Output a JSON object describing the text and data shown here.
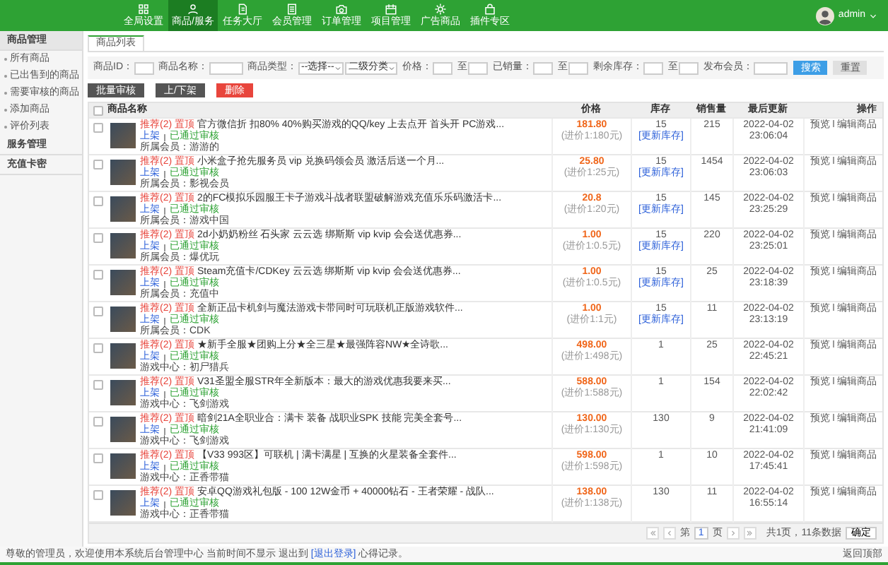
{
  "nav": [
    {
      "label": "全局设置",
      "selected": false
    },
    {
      "label": "商品/服务",
      "selected": true
    },
    {
      "label": "任务大厅",
      "selected": false
    },
    {
      "label": "会员管理",
      "selected": false
    },
    {
      "label": "订单管理",
      "selected": false
    },
    {
      "label": "项目管理",
      "selected": false
    },
    {
      "label": "广告商品",
      "selected": false
    },
    {
      "label": "插件专区",
      "selected": false
    }
  ],
  "user": {
    "name": "admin"
  },
  "sidebar": {
    "groups": [
      {
        "title": "商品管理",
        "expanded": true,
        "items": [
          {
            "label": "所有商品",
            "selected": false
          },
          {
            "label": "已出售到的商品",
            "selected": false
          },
          {
            "label": "需要审核的商品",
            "selected": false
          },
          {
            "label": "添加商品",
            "selected": false
          },
          {
            "label": "评价列表",
            "selected": false
          }
        ]
      },
      {
        "title": "服务管理",
        "expanded": false
      },
      {
        "title": "充值卡密",
        "expanded": false
      }
    ]
  },
  "tabs": [
    {
      "label": "商品列表",
      "selected": true
    }
  ],
  "filters": [
    {
      "label": "商品ID：",
      "kind": "input"
    },
    {
      "label": "商品名称：",
      "kind": "wide"
    },
    {
      "label": "商品类型：",
      "kind": "select",
      "value": "--选择--"
    },
    {
      "kind": "select",
      "value": "二级分类"
    },
    {
      "label": "价格：",
      "kind": "input"
    },
    {
      "label": "至",
      "kind": "input"
    },
    {
      "label": "已销量：",
      "kind": "input"
    },
    {
      "label": "至",
      "kind": "input"
    },
    {
      "label": "剩余库存：",
      "kind": "input"
    },
    {
      "label": "至",
      "kind": "input"
    },
    {
      "label": "发布会员：",
      "kind": "wide"
    }
  ],
  "filter_buttons": [
    {
      "label": "搜索",
      "kind": "primary"
    },
    {
      "label": "重置",
      "kind": "default"
    }
  ],
  "actions": [
    {
      "label": "批量审核",
      "kind": "dark"
    },
    {
      "label": "上/下架",
      "kind": "dark"
    },
    {
      "label": "删除",
      "kind": "danger"
    }
  ],
  "table": {
    "all_checked": false,
    "columns": [
      "商品名称",
      "价格",
      "库存",
      "销售量",
      "最后更新",
      "操作"
    ],
    "rows": [
      {
        "checked": false,
        "tags": "推荐(2) 置顶",
        "title": "官方微信折 扣80% 40%购买游戏的QQ/key 上去点开 首头开 PC游戏...",
        "status": "上架",
        "review": "已通过审核",
        "seller": "所属会员：游游的",
        "price": "181.80",
        "price_note": "(进价1:180元)",
        "stock": "15",
        "stock_action": "[更新库存]",
        "sold": "215",
        "date": "2022-04-02",
        "time": "23:06:04",
        "links": [
          "预览",
          "编辑商品"
        ]
      },
      {
        "checked": false,
        "tags": "推荐(2) 置顶",
        "title": "小米盒子抢先服务员 vip 兑换码领会员 激活后送一个月...",
        "status": "上架",
        "review": "已通过审核",
        "seller": "所属会员：影视会员",
        "price": "25.80",
        "price_note": "(进价1:25元)",
        "stock": "15",
        "stock_action": "[更新库存]",
        "sold": "1454",
        "date": "2022-04-02",
        "time": "23:06:03",
        "links": [
          "预览",
          "编辑商品"
        ]
      },
      {
        "checked": false,
        "tags": "推荐(2) 置顶",
        "title": "2的FC模拟乐园服王卡子游戏斗战者联盟破解游戏充值乐乐码激活卡...",
        "status": "上架",
        "review": "已通过审核",
        "seller": "所属会员：游戏中国",
        "price": "20.8",
        "price_note": "(进价1:20元)",
        "stock": "15",
        "stock_action": "[更新库存]",
        "sold": "145",
        "date": "2022-04-02",
        "time": "23:25:29",
        "links": [
          "预览",
          "编辑商品"
        ]
      },
      {
        "checked": false,
        "tags": "推荐(2) 置顶",
        "title": "2d小奶奶粉丝 石头家 云云选 绑斯斯 vip kvip 会会送优惠券...",
        "status": "上架",
        "review": "已通过审核",
        "seller": "所属会员：爆优玩",
        "price": "1.00",
        "price_note": "(进价1:0.5元)",
        "stock": "15",
        "stock_action": "[更新库存]",
        "sold": "220",
        "date": "2022-04-02",
        "time": "23:25:01",
        "links": [
          "预览",
          "编辑商品"
        ]
      },
      {
        "checked": false,
        "tags": "推荐(2) 置顶",
        "title": "Steam充值卡/CDKey 云云选 绑斯斯 vip kvip 会会送优惠券...",
        "status": "上架",
        "review": "已通过审核",
        "seller": "所属会员：充值中",
        "price": "1.00",
        "price_note": "(进价1:0.5元)",
        "stock": "15",
        "stock_action": "[更新库存]",
        "sold": "25",
        "date": "2022-04-02",
        "time": "23:18:39",
        "links": [
          "预览",
          "编辑商品"
        ]
      },
      {
        "checked": false,
        "tags": "推荐(2) 置顶",
        "title": "全新正品卡机剑与魔法游戏卡带同时可玩联机正版游戏软件...",
        "status": "上架",
        "review": "已通过审核",
        "seller": "所属会员：CDK",
        "price": "1.00",
        "price_note": "(进价1:1元)",
        "stock": "15",
        "stock_action": "[更新库存]",
        "sold": "11",
        "date": "2022-04-02",
        "time": "23:13:19",
        "links": [
          "预览",
          "编辑商品"
        ]
      },
      {
        "checked": false,
        "tags": "推荐(2) 置顶",
        "title": "★新手全服★团购上分★全三星★最强阵容NW★全诗歌...",
        "status": "上架",
        "review": "已通过审核",
        "seller": "游戏中心：初尸猎兵",
        "price": "498.00",
        "price_note": "(进价1:498元)",
        "stock": "1",
        "sold": "25",
        "date": "2022-04-02",
        "time": "22:45:21",
        "links": [
          "预览",
          "编辑商品"
        ]
      },
      {
        "checked": false,
        "tags": "推荐(2) 置顶",
        "title": "V31圣盟全服STR年全新版本：最大的游戏优惠我要来买...",
        "status": "上架",
        "review": "已通过审核",
        "seller": "游戏中心：飞剑游戏",
        "price": "588.00",
        "price_note": "(进价1:588元)",
        "stock": "1",
        "sold": "154",
        "date": "2022-04-02",
        "time": "22:02:42",
        "links": [
          "预览",
          "编辑商品"
        ]
      },
      {
        "checked": false,
        "tags": "推荐(2) 置顶",
        "title": "暗剑21A全职业合：满卡 装备 战职业SPK 技能 完美全套号...",
        "status": "上架",
        "review": "已通过审核",
        "seller": "游戏中心：飞剑游戏",
        "price": "130.00",
        "price_note": "(进价1:130元)",
        "stock": "130",
        "sold": "9",
        "date": "2022-04-02",
        "time": "21:41:09",
        "links": [
          "预览",
          "编辑商品"
        ]
      },
      {
        "checked": false,
        "tags": "推荐(2) 置顶",
        "title": "【V33 993区】可联机 | 满卡满星 | 互换的火星装备全套件...",
        "status": "上架",
        "review": "已通过审核",
        "seller": "游戏中心：正香带猫",
        "price": "598.00",
        "price_note": "(进价1:598元)",
        "stock": "1",
        "sold": "10",
        "date": "2022-04-02",
        "time": "17:45:41",
        "links": [
          "预览",
          "编辑商品"
        ]
      },
      {
        "checked": false,
        "tags": "推荐(2) 置顶",
        "title": "安卓QQ游戏礼包版 - 100 12W金币 + 40000钻石 - 王者荣耀 - 战队...",
        "status": "上架",
        "review": "已通过审核",
        "seller": "游戏中心：正香带猫",
        "price": "138.00",
        "price_note": "(进价1:138元)",
        "stock": "130",
        "sold": "11",
        "date": "2022-04-02",
        "time": "16:55:14",
        "links": [
          "预览",
          "编辑商品"
        ]
      }
    ]
  },
  "pagination": {
    "prefix": "第",
    "page": "1",
    "suffix": "页",
    "summary": "共1页，11条数据",
    "go": "确定"
  },
  "footer": {
    "text": "尊敬的管理员，欢迎使用本系统后台管理中心   当前时间不显示   退出到",
    "link": "[退出登录]",
    "after": "心得记录。",
    "right": "返回顶部"
  }
}
